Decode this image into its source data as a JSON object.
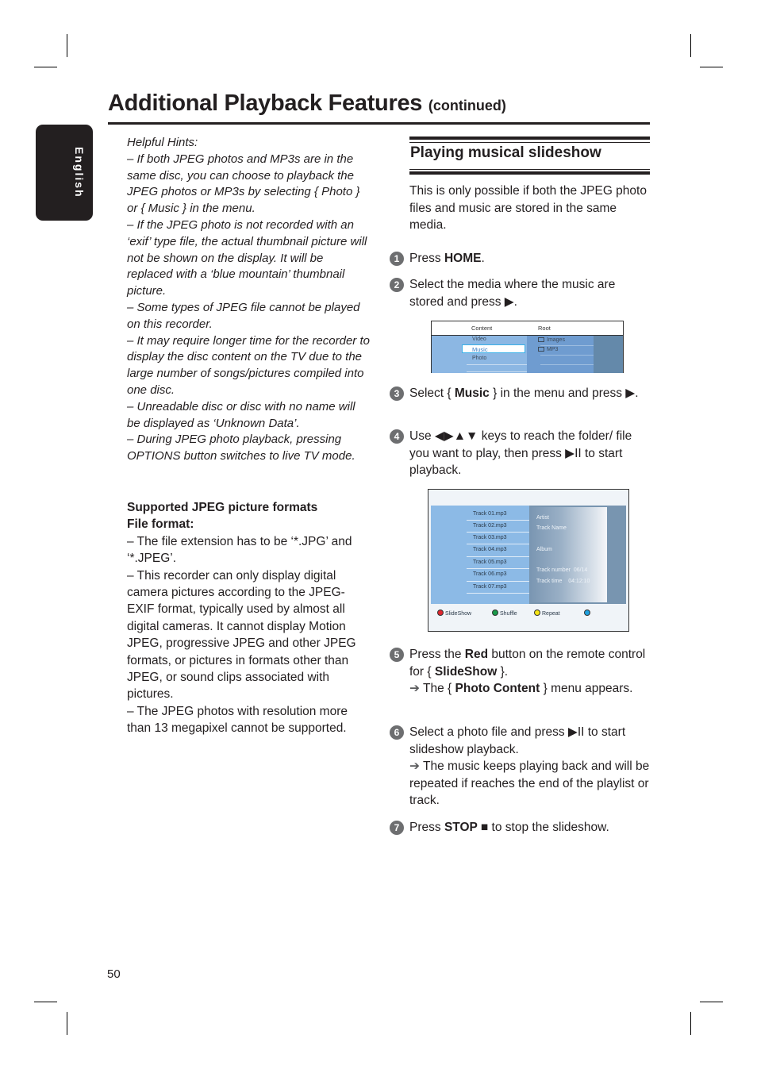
{
  "header": {
    "title": "Additional Playback Features",
    "title_suffix": "(continued)"
  },
  "language_tab": "English",
  "left_column": {
    "hints_title": "Helpful Hints:",
    "hints": [
      "– If both JPEG photos and MP3s are in the same disc, you can choose to playback the JPEG photos or MP3s by selecting { Photo } or { Music } in the menu.",
      "– If the JPEG photo is not recorded with an ‘exif’ type file, the actual thumbnail picture will not be shown on the display.  It will be replaced with a ‘blue mountain’ thumbnail picture.",
      "– Some types of JPEG file cannot be played on this recorder.",
      "– It may require longer time for the recorder to display the disc content on the TV due to the large number of songs/pictures compiled into one disc.",
      "– Unreadable disc or disc with no name will be displayed as ‘Unknown Data’.",
      "– During JPEG photo playback, pressing OPTIONS button switches to live TV mode."
    ],
    "formats_heading": "Supported JPEG picture formats",
    "formats_subheading": "File format:",
    "formats": [
      "– The file extension has to be ‘*.JPG’ and ‘*.JPEG’.",
      "– This recorder can only display digital camera pictures according to the JPEG-EXIF format, typically used by almost all digital cameras.  It cannot display Motion JPEG, progressive JPEG and other JPEG formats, or pictures in formats other than JPEG, or sound clips associated with pictures.",
      "– The JPEG photos with resolution more than 13 megapixel cannot be supported."
    ]
  },
  "section": {
    "title": "Playing musical slideshow",
    "intro": "This is only possible if both the JPEG photo files and music are stored in the same media.",
    "steps": [
      {
        "num": "1",
        "pre": "Press ",
        "bold": "HOME",
        "post": "."
      },
      {
        "num": "2",
        "text": "Select the media where the music are stored and press ▶."
      },
      {
        "num": "3",
        "pre": "Select { ",
        "bold": "Music",
        "post": " } in the menu and press ▶."
      },
      {
        "num": "4",
        "text": "Use ◀▶▲▼ keys to reach the folder/ file you want to play, then press ▶II to start playback."
      },
      {
        "num": "5",
        "pre": "Press the ",
        "bold": "Red",
        "mid": " button on the remote control for { ",
        "bold2": "SlideShow",
        "post": " }.",
        "result_arrow": "➔",
        "result_pre": " The { ",
        "result_bold": "Photo Content",
        "result_post": " } menu appears."
      },
      {
        "num": "6",
        "text": "Select a photo file and press ▶II to start slideshow playback.",
        "result_arrow": "➔",
        "result": " The music keeps playing back and will be repeated if reaches the end of the playlist or track."
      },
      {
        "num": "7",
        "pre": "Press ",
        "bold": "STOP ■",
        "post": " to stop the slideshow."
      }
    ]
  },
  "screen1": {
    "col1_header": "Content",
    "col2_header": "Root",
    "items": [
      "Video",
      "Music",
      "Photo"
    ],
    "selected": "Music",
    "folders": [
      "Images",
      "MP3"
    ]
  },
  "screen2": {
    "tracks": [
      "Track 01.mp3",
      "Track 02.mp3",
      "Track 03.mp3",
      "Track 04.mp3",
      "Track 05.mp3",
      "Track 06.mp3",
      "Track 07.mp3"
    ],
    "info": {
      "artist": "Artist",
      "track_name": "Track Name",
      "album": "Album",
      "track_number_label": "Track number",
      "track_number": "06/14",
      "track_time_label": "Track time",
      "track_time": "04:12:10"
    },
    "buttons": [
      {
        "label": "SlideShow",
        "color": "#e0262e"
      },
      {
        "label": "Shuffle",
        "color": "#1a9a4a"
      },
      {
        "label": "Repeat",
        "color": "#f5e414"
      },
      {
        "label": "",
        "color": "#1ea0de"
      }
    ]
  },
  "footer": {
    "page_number": "50"
  }
}
